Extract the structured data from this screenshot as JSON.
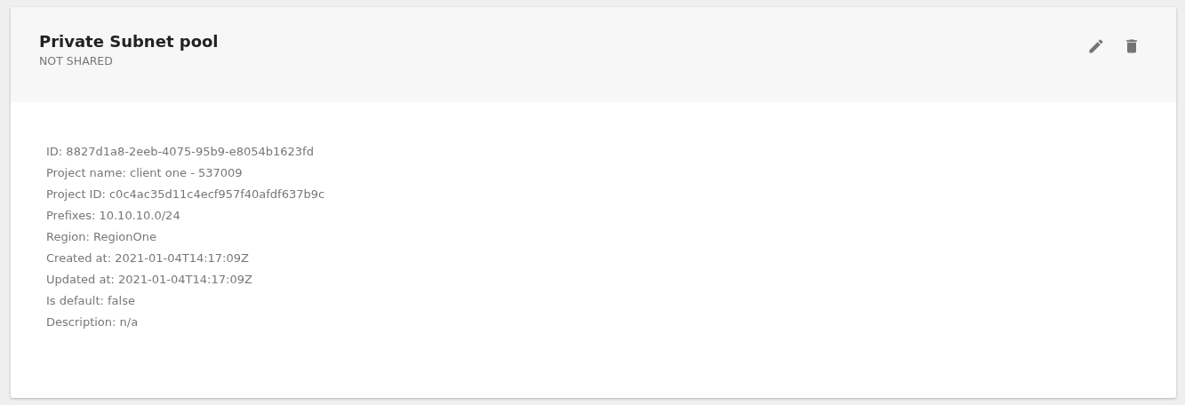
{
  "card": {
    "title": "Private Subnet pool",
    "subtitle": "NOT SHARED",
    "details": [
      "ID: 8827d1a8-2eeb-4075-95b9-e8054b1623fd",
      "Project name: client one - 537009",
      "Project ID: c0c4ac35d11c4ecf957f40afdf637b9c",
      "Prefixes: 10.10.10.0/24",
      "Region: RegionOne",
      "Created at: 2021-01-04T14:17:09Z",
      "Updated at: 2021-01-04T14:17:09Z",
      "Is default: false",
      "Description: n/a"
    ]
  }
}
